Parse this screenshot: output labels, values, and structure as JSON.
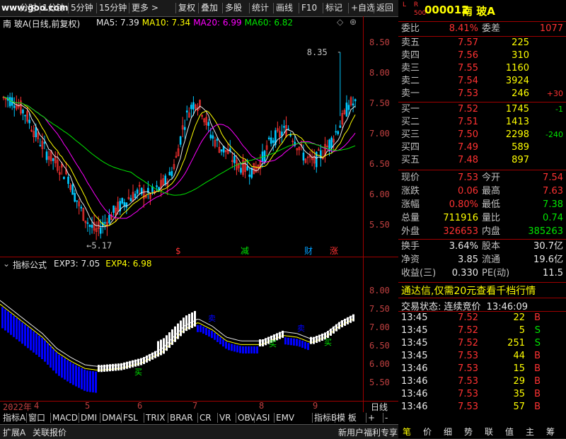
{
  "toolbar": {
    "items": [
      "分时",
      "1分钟",
      "5分钟",
      "15分钟",
      "更多 >",
      "复权",
      "叠加",
      "多股",
      "统计",
      "画线",
      "F10",
      "标记",
      "+自选",
      "返回"
    ],
    "watermark": "www.goo.com"
  },
  "main_chart": {
    "title": "南 玻A(日线,前复权)",
    "ma_labels": [
      {
        "text": "MA5: 7.39",
        "color": "#e8e8e8"
      },
      {
        "text": "MA10: 7.34",
        "color": "#ffff00"
      },
      {
        "text": "MA20: 6.99",
        "color": "#ff00ff"
      },
      {
        "text": "MA60: 6.82",
        "color": "#00e600"
      }
    ],
    "y_ticks": [
      "8.50",
      "8.00",
      "7.50",
      "7.00",
      "6.50",
      "6.00",
      "5.50"
    ],
    "annotations": {
      "high": "8.35",
      "low": "5.17"
    },
    "event_markers": [
      {
        "text": "$",
        "color": "#ff3232"
      },
      {
        "text": "减",
        "color": "#00e600"
      },
      {
        "text": "财",
        "color": "#00a0ff"
      },
      {
        "text": "涨",
        "color": "#ff3232"
      }
    ]
  },
  "indicator_chart": {
    "title": "指标公式",
    "labels": [
      {
        "text": "EXP3: 7.05",
        "color": "#e8e8e8"
      },
      {
        "text": "EXP4: 6.98",
        "color": "#ffff00"
      }
    ],
    "y_ticks": [
      "8.00",
      "7.50",
      "7.00",
      "6.50",
      "6.00",
      "5.50"
    ],
    "buy_label": "买",
    "sell_label": "卖"
  },
  "x_axis": {
    "labels": [
      "2022年",
      "4",
      "5",
      "6",
      "7",
      "8",
      "9"
    ],
    "period": "日线"
  },
  "bottom_tabs": [
    "指标A",
    "窗口",
    "MACD",
    "DMI",
    "DMA",
    "FSL",
    "TRIX",
    "BRAR",
    "CR",
    "VR",
    "OBV",
    "ASI",
    "EMV",
    "指标B",
    "模 板",
    "+",
    "-"
  ],
  "status_bar": {
    "left1": "扩展A",
    "left2": "关联报价",
    "right": "新用户福利专享"
  },
  "right_panel": {
    "badge_top": "L  R",
    "badge_sub": "500",
    "code": "000012",
    "name": "南 玻A",
    "weibi_label": "委比",
    "weibi": "8.41%",
    "weicha_label": "委差",
    "weicha": "1077",
    "asks": [
      {
        "label": "卖五",
        "price": "7.57",
        "vol": "225",
        "chg": ""
      },
      {
        "label": "卖四",
        "price": "7.56",
        "vol": "310",
        "chg": ""
      },
      {
        "label": "卖三",
        "price": "7.55",
        "vol": "1160",
        "chg": ""
      },
      {
        "label": "卖二",
        "price": "7.54",
        "vol": "3924",
        "chg": ""
      },
      {
        "label": "卖一",
        "price": "7.53",
        "vol": "246",
        "chg": "+30"
      }
    ],
    "bids": [
      {
        "label": "买一",
        "price": "7.52",
        "vol": "1745",
        "chg": "-1"
      },
      {
        "label": "买二",
        "price": "7.51",
        "vol": "1413",
        "chg": ""
      },
      {
        "label": "买三",
        "price": "7.50",
        "vol": "2298",
        "chg": "-240"
      },
      {
        "label": "买四",
        "price": "7.49",
        "vol": "589",
        "chg": ""
      },
      {
        "label": "买五",
        "price": "7.48",
        "vol": "897",
        "chg": ""
      }
    ],
    "quote": [
      {
        "l1": "现价",
        "v1": "7.53",
        "c1": "red",
        "l2": "今开",
        "v2": "7.54",
        "c2": "red"
      },
      {
        "l1": "涨跌",
        "v1": "0.06",
        "c1": "red",
        "l2": "最高",
        "v2": "7.63",
        "c2": "red"
      },
      {
        "l1": "涨幅",
        "v1": "0.80%",
        "c1": "red",
        "l2": "最低",
        "v2": "7.38",
        "c2": "green"
      },
      {
        "l1": "总量",
        "v1": "711916",
        "c1": "yellow",
        "l2": "量比",
        "v2": "0.74",
        "c2": "green"
      },
      {
        "l1": "外盘",
        "v1": "326653",
        "c1": "red",
        "l2": "内盘",
        "v2": "385263",
        "c2": "green"
      }
    ],
    "fund": [
      {
        "l1": "换手",
        "v1": "3.64%",
        "l2": "股本",
        "v2": "30.7亿"
      },
      {
        "l1": "净资",
        "v1": "3.85",
        "l2": "流通",
        "v2": "19.6亿"
      },
      {
        "l1": "收益(三)",
        "v1": "0.330",
        "l2": "PE(动)",
        "v2": "11.5"
      }
    ],
    "promo": "通达信,仅需20元查看千档行情",
    "trade_status_label": "交易状态: 连续竞价",
    "trade_time": "13:46:09",
    "ticks": [
      {
        "time": "13:45",
        "price": "7.52",
        "vol": "22",
        "side": "B"
      },
      {
        "time": "13:45",
        "price": "7.52",
        "vol": "5",
        "side": "S"
      },
      {
        "time": "13:45",
        "price": "7.52",
        "vol": "251",
        "side": "S"
      },
      {
        "time": "13:45",
        "price": "7.53",
        "vol": "44",
        "side": "B"
      },
      {
        "time": "13:46",
        "price": "7.53",
        "vol": "15",
        "side": "B"
      },
      {
        "time": "13:46",
        "price": "7.53",
        "vol": "29",
        "side": "B"
      },
      {
        "time": "13:46",
        "price": "7.53",
        "vol": "35",
        "side": "B"
      },
      {
        "time": "13:46",
        "price": "7.53",
        "vol": "57",
        "side": "B"
      }
    ],
    "bottom_tabs": [
      "笔",
      "价",
      "细",
      "势",
      "联",
      "值",
      "主",
      "筹"
    ]
  }
}
